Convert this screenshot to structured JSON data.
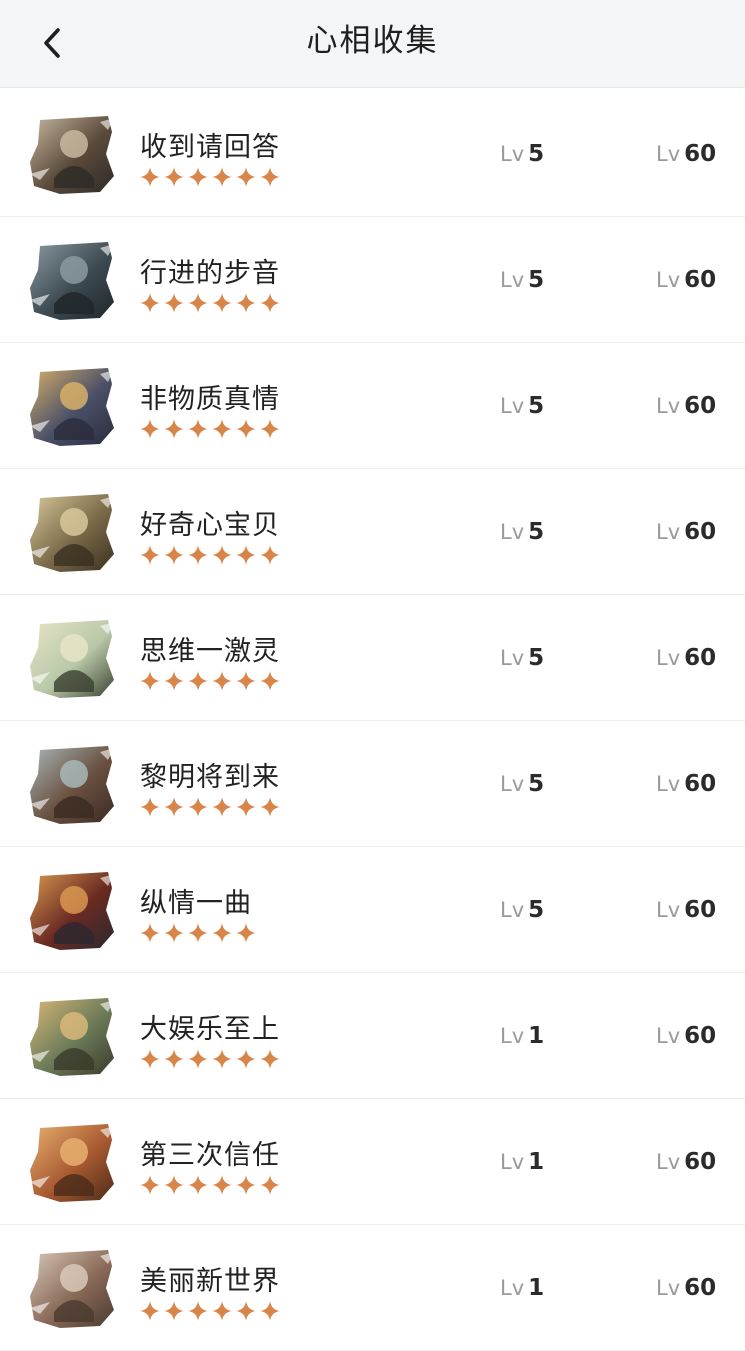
{
  "header": {
    "title": "心相收集",
    "back_icon": "chevron-left-icon"
  },
  "colors": {
    "star": "#d9854a",
    "header_bg": "#f4f5f7"
  },
  "items": [
    {
      "name": "收到请回答",
      "stars": 6,
      "level": "5",
      "max_level": "60",
      "level_label": "Lv",
      "max_label": "Lv",
      "palette": [
        "#5a4a3a",
        "#c9b8a0",
        "#2e2a28"
      ]
    },
    {
      "name": "行进的步音",
      "stars": 6,
      "level": "5",
      "max_level": "60",
      "level_label": "Lv",
      "max_label": "Lv",
      "palette": [
        "#3d4a52",
        "#8b9aa0",
        "#1f2628"
      ]
    },
    {
      "name": "非物质真情",
      "stars": 6,
      "level": "5",
      "max_level": "60",
      "level_label": "Lv",
      "max_label": "Lv",
      "palette": [
        "#4a5068",
        "#d8b068",
        "#2a2c3c"
      ]
    },
    {
      "name": "好奇心宝贝",
      "stars": 6,
      "level": "5",
      "max_level": "60",
      "level_label": "Lv",
      "max_label": "Lv",
      "palette": [
        "#7a6a48",
        "#d8c89a",
        "#3a3020"
      ]
    },
    {
      "name": "思维一激灵",
      "stars": 6,
      "level": "5",
      "max_level": "60",
      "level_label": "Lv",
      "max_label": "Lv",
      "palette": [
        "#b8c8a8",
        "#e8e4c8",
        "#3a4030"
      ]
    },
    {
      "name": "黎明将到来",
      "stars": 6,
      "level": "5",
      "max_level": "60",
      "level_label": "Lv",
      "max_label": "Lv",
      "palette": [
        "#6a5040",
        "#a8b8b8",
        "#3a2a22"
      ]
    },
    {
      "name": "纵情一曲",
      "stars": 5,
      "level": "5",
      "max_level": "60",
      "level_label": "Lv",
      "max_label": "Lv",
      "palette": [
        "#6a2a22",
        "#d89850",
        "#2a2830"
      ]
    },
    {
      "name": "大娱乐至上",
      "stars": 6,
      "level": "1",
      "max_level": "60",
      "level_label": "Lv",
      "max_label": "Lv",
      "palette": [
        "#6a7a58",
        "#d8b878",
        "#3a3a2a"
      ]
    },
    {
      "name": "第三次信任",
      "stars": 6,
      "level": "1",
      "max_level": "60",
      "level_label": "Lv",
      "max_label": "Lv",
      "palette": [
        "#a85a30",
        "#e8b070",
        "#4a2a1a"
      ]
    },
    {
      "name": "美丽新世界",
      "stars": 6,
      "level": "1",
      "max_level": "60",
      "level_label": "Lv",
      "max_label": "Lv",
      "palette": [
        "#8a6a58",
        "#d8c8b8",
        "#4a3a30"
      ]
    }
  ]
}
